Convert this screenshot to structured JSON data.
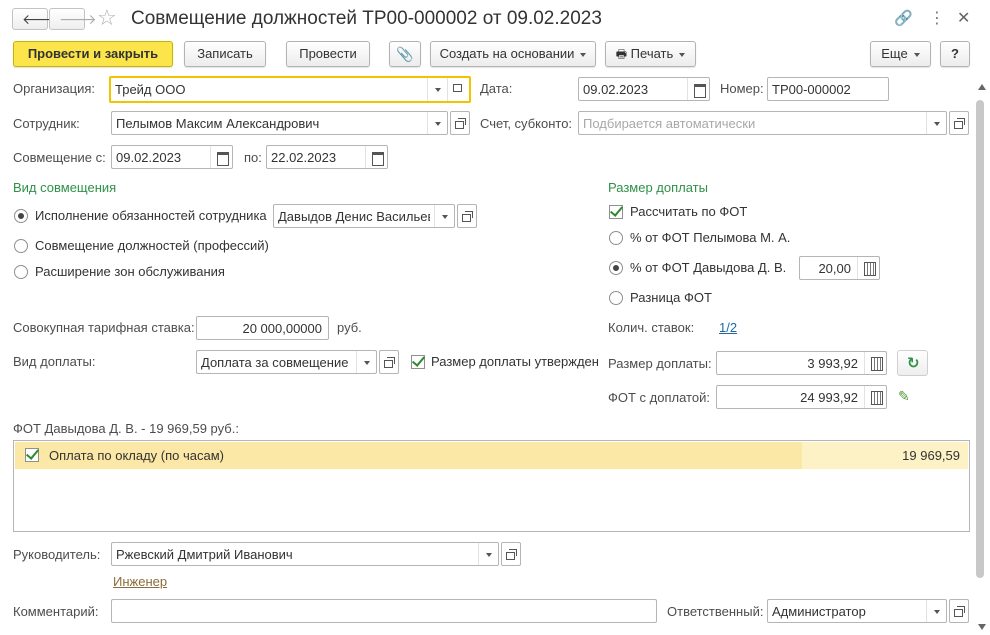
{
  "window": {
    "title": "Совмещение должностей ТР00-000002 от 09.02.2023"
  },
  "toolbar": {
    "post_close": "Провести и закрыть",
    "save": "Записать",
    "post": "Провести",
    "create_based": "Создать на основании",
    "print": "Печать",
    "more": "Еще",
    "help": "?"
  },
  "form": {
    "org_label": "Организация:",
    "org_value": "Трейд ООО",
    "date_label": "Дата:",
    "date_value": "09.02.2023",
    "number_label": "Номер:",
    "number_value": "ТР00-000002",
    "employee_label": "Сотрудник:",
    "employee_value": "Пелымов Максим Александрович",
    "account_label": "Счет, субконто:",
    "account_placeholder": "Подбирается автоматически",
    "from_label": "Совмещение с:",
    "from_value": "09.02.2023",
    "to_label": "по:",
    "to_value": "22.02.2023"
  },
  "kind": {
    "title": "Вид совмещения",
    "opt1": "Исполнение обязанностей сотрудника",
    "opt1_employee": "Давыдов Денис Васильевич",
    "opt2": "Совмещение должностей (профессий)",
    "opt3": "Расширение зон обслуживания"
  },
  "pay": {
    "title": "Размер доплаты",
    "calc_fot": "Рассчитать по ФОТ",
    "pct_pelymov": "% от ФОТ Пелымова М. А.",
    "pct_davydov": "% от ФОТ Давыдова Д. В.",
    "pct_value": "20,00",
    "diff_fot": "Разница ФОТ",
    "rates_label": "Колич. ставок:",
    "rates_value": "1/2",
    "amount_label": "Размер доплаты:",
    "amount_value": "3 993,92",
    "fot_label": "ФОТ с доплатой:",
    "fot_value": "24 993,92"
  },
  "tariff": {
    "label": "Совокупная тарифная ставка:",
    "value": "20 000,00000",
    "unit": "руб."
  },
  "surcharge": {
    "label": "Вид доплаты:",
    "value": "Доплата за совмещение должностей",
    "approved": "Размер доплаты утвержден"
  },
  "fot_table": {
    "caption": "ФОТ Давыдова Д. В. - 19 969,59 руб.:",
    "rows": [
      {
        "name": "Оплата по окладу (по часам)",
        "amount": "19 969,59"
      }
    ]
  },
  "footer": {
    "head_label": "Руководитель:",
    "head_value": "Ржевский Дмитрий Иванович",
    "head_position": "Инженер",
    "comment_label": "Комментарий:",
    "comment_value": "",
    "responsible_label": "Ответственный:",
    "responsible_value": "Администратор"
  }
}
